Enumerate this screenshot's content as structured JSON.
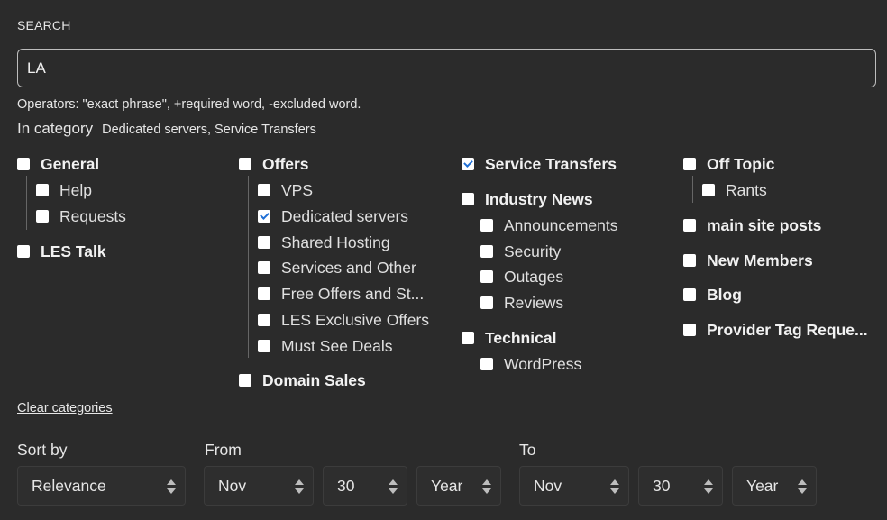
{
  "search": {
    "label": "SEARCH",
    "value": "LA",
    "operators_help": "Operators: \"exact phrase\", +required word, -excluded word."
  },
  "in_category": {
    "label": "In category",
    "selected_text": "Dedicated servers, Service Transfers"
  },
  "categories": {
    "general": {
      "label": "General",
      "checked": false
    },
    "help": {
      "label": "Help",
      "checked": false
    },
    "requests": {
      "label": "Requests",
      "checked": false
    },
    "les_talk": {
      "label": "LES Talk",
      "checked": false
    },
    "offers": {
      "label": "Offers",
      "checked": false
    },
    "vps": {
      "label": "VPS",
      "checked": false
    },
    "dedicated": {
      "label": "Dedicated servers",
      "checked": true
    },
    "shared": {
      "label": "Shared Hosting",
      "checked": false
    },
    "services_other": {
      "label": "Services and Other",
      "checked": false
    },
    "free_offers": {
      "label": "Free Offers and St...",
      "checked": false
    },
    "les_exclusive": {
      "label": "LES Exclusive Offers",
      "checked": false
    },
    "must_see": {
      "label": "Must See Deals",
      "checked": false
    },
    "domain_sales": {
      "label": "Domain Sales",
      "checked": false
    },
    "service_transfers": {
      "label": "Service Transfers",
      "checked": true
    },
    "industry_news": {
      "label": "Industry News",
      "checked": false
    },
    "announcements": {
      "label": "Announcements",
      "checked": false
    },
    "security": {
      "label": "Security",
      "checked": false
    },
    "outages": {
      "label": "Outages",
      "checked": false
    },
    "reviews": {
      "label": "Reviews",
      "checked": false
    },
    "technical": {
      "label": "Technical",
      "checked": false
    },
    "wordpress": {
      "label": "WordPress",
      "checked": false
    },
    "off_topic": {
      "label": "Off Topic",
      "checked": false
    },
    "rants": {
      "label": "Rants",
      "checked": false
    },
    "main_site_posts": {
      "label": "main site posts",
      "checked": false
    },
    "new_members": {
      "label": "New Members",
      "checked": false
    },
    "blog": {
      "label": "Blog",
      "checked": false
    },
    "provider_tag": {
      "label": "Provider Tag Reque...",
      "checked": false
    }
  },
  "clear_categories": "Clear categories",
  "filters": {
    "sort_by_label": "Sort by",
    "sort_by_value": "Relevance",
    "from_label": "From",
    "from_month": "Nov",
    "from_day": "30",
    "from_year": "Year",
    "to_label": "To",
    "to_month": "Nov",
    "to_day": "30",
    "to_year": "Year"
  }
}
